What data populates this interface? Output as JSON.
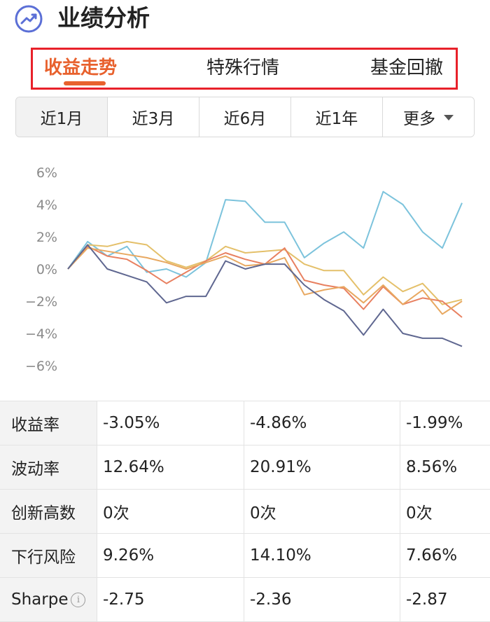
{
  "header": {
    "title": "业绩分析",
    "icon": "trend-chart-icon"
  },
  "tabs": [
    {
      "label": "收益走势",
      "active": true
    },
    {
      "label": "特殊行情",
      "active": false
    },
    {
      "label": "基金回撤",
      "active": false
    }
  ],
  "periods": [
    {
      "label": "近1月",
      "active": true
    },
    {
      "label": "近3月",
      "active": false
    },
    {
      "label": "近6月",
      "active": false
    },
    {
      "label": "近1年",
      "active": false
    },
    {
      "label": "更多",
      "active": false,
      "dropdown": true
    }
  ],
  "colors": {
    "accent": "#e8612d",
    "border_highlight": "#e8212a",
    "negative": "#d0021b"
  },
  "chart_data": {
    "type": "line",
    "y_ticks": [
      "6%",
      "4%",
      "2%",
      "0%",
      "−2%",
      "−4%",
      "−6%"
    ],
    "ylim": [
      -6,
      6
    ],
    "x": [
      0,
      1,
      2,
      3,
      4,
      5,
      6,
      7,
      8,
      9,
      10,
      11,
      12,
      13,
      14,
      15,
      16,
      17,
      18,
      19,
      20
    ],
    "grid": false,
    "series": [
      {
        "color": "#7cc3dc",
        "values": [
          0,
          1.7,
          0.8,
          1.4,
          -0.2,
          0.0,
          -0.5,
          0.4,
          4.3,
          4.2,
          2.9,
          2.9,
          0.7,
          1.6,
          2.3,
          1.3,
          4.8,
          4.0,
          2.3,
          1.3,
          4.1
        ]
      },
      {
        "color": "#e4c06a",
        "values": [
          0,
          1.5,
          1.4,
          1.7,
          1.5,
          0.5,
          0.1,
          0.5,
          1.4,
          1.0,
          1.1,
          1.2,
          0.3,
          -0.1,
          -0.1,
          -1.6,
          -0.5,
          -1.4,
          -0.9,
          -2.2,
          -1.9
        ]
      },
      {
        "color": "#e88060",
        "values": [
          0,
          1.4,
          0.8,
          0.6,
          -0.1,
          -0.9,
          -0.2,
          0.5,
          1.0,
          0.6,
          0.3,
          1.3,
          -0.7,
          -1.0,
          -1.2,
          -2.5,
          -1.1,
          -2.2,
          -1.8,
          -2.0,
          -3.0
        ]
      },
      {
        "color": "#e8a860",
        "values": [
          0,
          1.3,
          1.1,
          0.9,
          0.7,
          0.4,
          0.0,
          0.4,
          0.8,
          0.2,
          0.3,
          0.7,
          -1.6,
          -1.3,
          -1.1,
          -2.1,
          -1.0,
          -2.2,
          -1.3,
          -2.8,
          -2.0
        ]
      },
      {
        "color": "#5f6790",
        "values": [
          0,
          1.5,
          0.0,
          -0.4,
          -0.8,
          -2.1,
          -1.7,
          -1.7,
          0.5,
          0.0,
          0.3,
          0.3,
          -1.0,
          -1.9,
          -2.6,
          -4.1,
          -2.5,
          -4.0,
          -4.3,
          -4.3,
          -4.8
        ]
      }
    ]
  },
  "stats": [
    {
      "label": "收益率",
      "values": [
        "-3.05%",
        "-4.86%",
        "-1.99%"
      ],
      "highlight": [
        false,
        false,
        false
      ]
    },
    {
      "label": "波动率",
      "values": [
        "12.64%",
        "20.91%",
        "8.56%"
      ],
      "highlight": [
        false,
        false,
        true
      ]
    },
    {
      "label": "创新高数",
      "values": [
        "0次",
        "0次",
        "0次"
      ],
      "highlight": [
        false,
        false,
        false
      ]
    },
    {
      "label": "下行风险",
      "values": [
        "9.26%",
        "14.10%",
        "7.66%"
      ],
      "highlight": [
        false,
        false,
        false
      ]
    },
    {
      "label": "Sharpe",
      "values": [
        "-2.75",
        "-2.36",
        "-2.87"
      ],
      "highlight": [
        false,
        false,
        false
      ],
      "info_icon": "i"
    }
  ]
}
